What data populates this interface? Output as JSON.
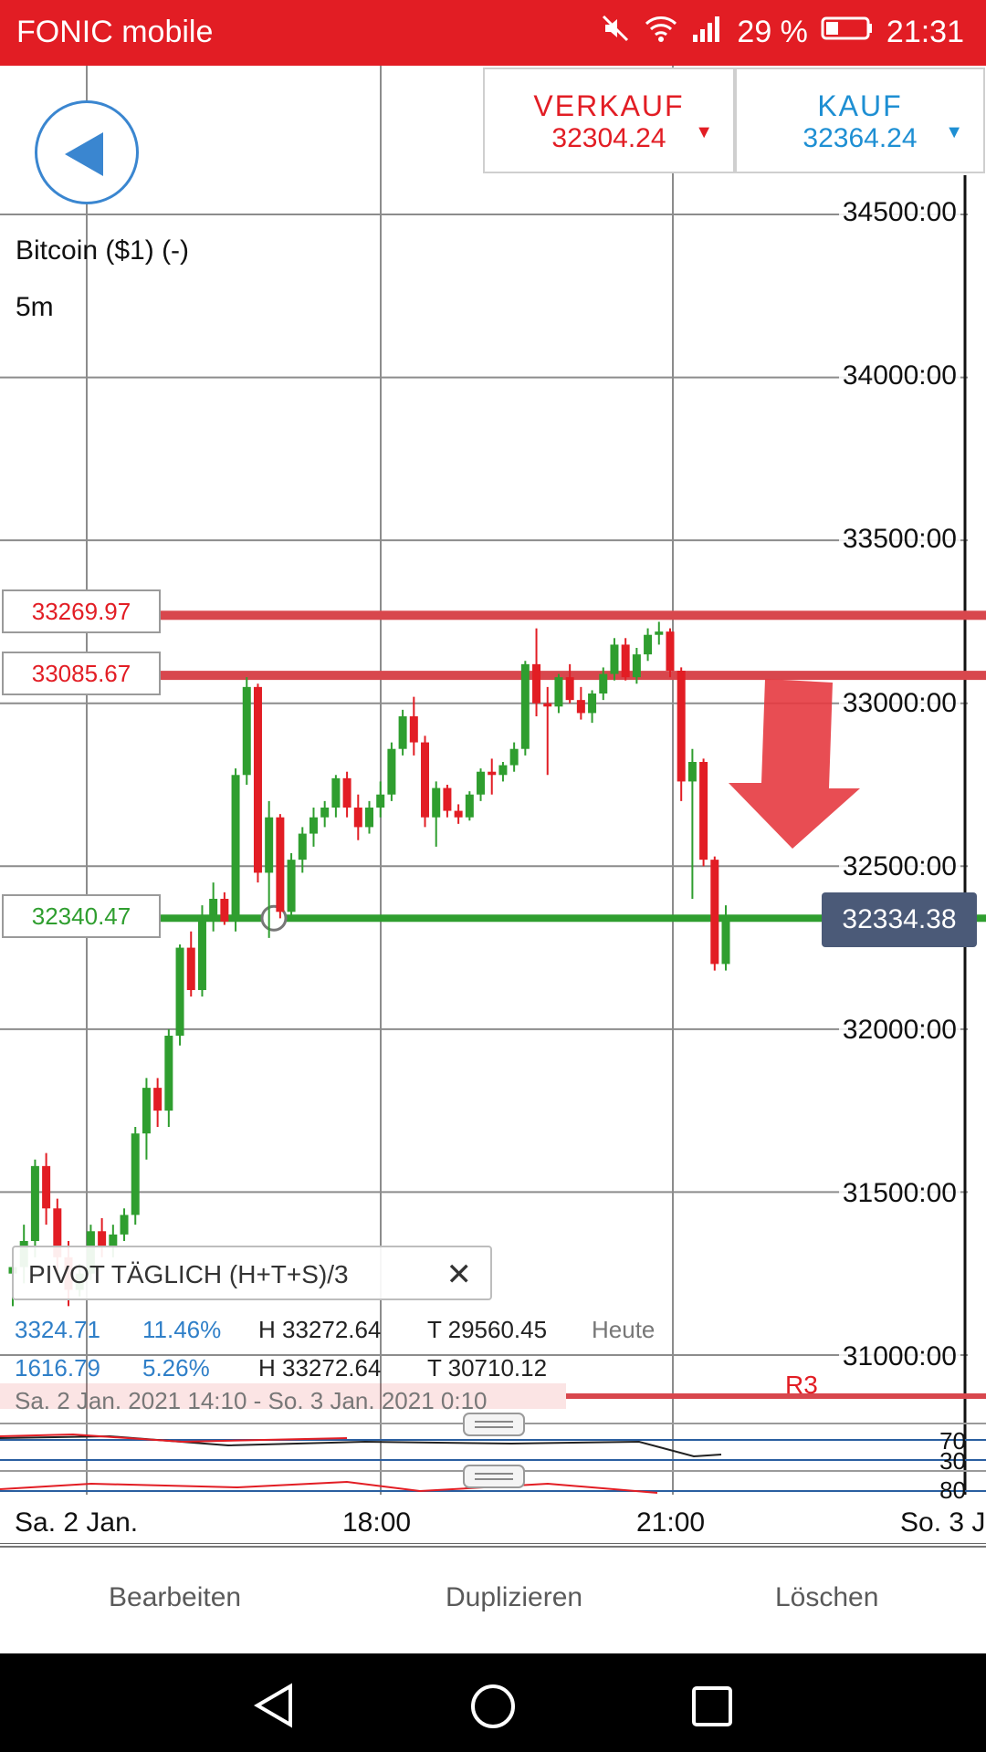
{
  "status_bar": {
    "carrier": "FONIC mobile",
    "battery": "29 %",
    "time": "21:31"
  },
  "trade": {
    "sell_label": "VERKAUF",
    "sell_price": "32304.24",
    "buy_label": "KAUF",
    "buy_price": "32364.24"
  },
  "instrument": {
    "name": "Bitcoin ($1) (-)",
    "timeframe": "5m"
  },
  "levels": {
    "upper": "33269.97",
    "lower": "33085.67",
    "current_line": "32340.47"
  },
  "current_price": "32334.38",
  "y_ticks": [
    "34500:00",
    "34000:00",
    "33500:00",
    "33000:00",
    "32500:00",
    "32000:00",
    "31500:00",
    "31000:00"
  ],
  "x_ticks": [
    "Sa. 2 Jan.",
    "18:00",
    "21:00",
    "So. 3 J"
  ],
  "pivot": {
    "label": "PIVOT  TÄGLICH   (H+T+S)/3",
    "row1": {
      "a": "3324.71",
      "b": "11.46%",
      "h": "H 33272.64",
      "t": "T 29560.45",
      "day": "Heute"
    },
    "row2": {
      "a": "1616.79",
      "b": "5.26%",
      "h": "H 33272.64",
      "t": "T 30710.12"
    },
    "range": "Sa. 2 Jan. 2021 14:10 - So. 3 Jan. 2021 0:10",
    "r3": "R3"
  },
  "oscillator_ticks": [
    "70",
    "30",
    "80"
  ],
  "actions": {
    "edit": "Bearbeiten",
    "duplicate": "Duplizieren",
    "delete": "Löschen"
  },
  "colors": {
    "brand": "#e21d24",
    "up": "#2f9e2f",
    "down": "#e21d24",
    "buy": "#1e8fd3"
  },
  "chart_data": {
    "type": "candlestick",
    "ylim": [
      30880,
      34800
    ],
    "candles": [
      {
        "o": 31250,
        "h": 31300,
        "l": 31150,
        "c": 31270
      },
      {
        "o": 31270,
        "h": 31400,
        "l": 31220,
        "c": 31350
      },
      {
        "o": 31350,
        "h": 31600,
        "l": 31300,
        "c": 31580
      },
      {
        "o": 31580,
        "h": 31620,
        "l": 31400,
        "c": 31450
      },
      {
        "o": 31450,
        "h": 31480,
        "l": 31250,
        "c": 31300
      },
      {
        "o": 31300,
        "h": 31350,
        "l": 31150,
        "c": 31200
      },
      {
        "o": 31200,
        "h": 31280,
        "l": 31180,
        "c": 31250
      },
      {
        "o": 31250,
        "h": 31400,
        "l": 31230,
        "c": 31380
      },
      {
        "o": 31380,
        "h": 31420,
        "l": 31300,
        "c": 31330
      },
      {
        "o": 31330,
        "h": 31400,
        "l": 31300,
        "c": 31370
      },
      {
        "o": 31370,
        "h": 31450,
        "l": 31350,
        "c": 31430
      },
      {
        "o": 31430,
        "h": 31700,
        "l": 31400,
        "c": 31680
      },
      {
        "o": 31680,
        "h": 31850,
        "l": 31600,
        "c": 31820
      },
      {
        "o": 31820,
        "h": 31850,
        "l": 31700,
        "c": 31750
      },
      {
        "o": 31750,
        "h": 32000,
        "l": 31700,
        "c": 31980
      },
      {
        "o": 31980,
        "h": 32260,
        "l": 31950,
        "c": 32250
      },
      {
        "o": 32250,
        "h": 32300,
        "l": 32100,
        "c": 32120
      },
      {
        "o": 32120,
        "h": 32380,
        "l": 32100,
        "c": 32350
      },
      {
        "o": 32350,
        "h": 32450,
        "l": 32300,
        "c": 32400
      },
      {
        "o": 32400,
        "h": 32420,
        "l": 32320,
        "c": 32330
      },
      {
        "o": 32330,
        "h": 32800,
        "l": 32300,
        "c": 32780
      },
      {
        "o": 32780,
        "h": 33080,
        "l": 32750,
        "c": 33050
      },
      {
        "o": 33050,
        "h": 33060,
        "l": 32450,
        "c": 32480
      },
      {
        "o": 32480,
        "h": 32700,
        "l": 32280,
        "c": 32650
      },
      {
        "o": 32650,
        "h": 32660,
        "l": 32340,
        "c": 32360
      },
      {
        "o": 32360,
        "h": 32540,
        "l": 32340,
        "c": 32520
      },
      {
        "o": 32520,
        "h": 32620,
        "l": 32480,
        "c": 32600
      },
      {
        "o": 32600,
        "h": 32680,
        "l": 32560,
        "c": 32650
      },
      {
        "o": 32650,
        "h": 32700,
        "l": 32620,
        "c": 32680
      },
      {
        "o": 32680,
        "h": 32780,
        "l": 32650,
        "c": 32770
      },
      {
        "o": 32770,
        "h": 32790,
        "l": 32650,
        "c": 32680
      },
      {
        "o": 32680,
        "h": 32720,
        "l": 32580,
        "c": 32620
      },
      {
        "o": 32620,
        "h": 32700,
        "l": 32600,
        "c": 32680
      },
      {
        "o": 32680,
        "h": 32760,
        "l": 32650,
        "c": 32720
      },
      {
        "o": 32720,
        "h": 32880,
        "l": 32700,
        "c": 32860
      },
      {
        "o": 32860,
        "h": 32980,
        "l": 32840,
        "c": 32960
      },
      {
        "o": 32960,
        "h": 33020,
        "l": 32840,
        "c": 32880
      },
      {
        "o": 32880,
        "h": 32900,
        "l": 32620,
        "c": 32650
      },
      {
        "o": 32650,
        "h": 32760,
        "l": 32560,
        "c": 32740
      },
      {
        "o": 32740,
        "h": 32750,
        "l": 32650,
        "c": 32670
      },
      {
        "o": 32670,
        "h": 32690,
        "l": 32630,
        "c": 32650
      },
      {
        "o": 32650,
        "h": 32730,
        "l": 32640,
        "c": 32720
      },
      {
        "o": 32720,
        "h": 32800,
        "l": 32700,
        "c": 32790
      },
      {
        "o": 32790,
        "h": 32830,
        "l": 32720,
        "c": 32780
      },
      {
        "o": 32780,
        "h": 32820,
        "l": 32760,
        "c": 32810
      },
      {
        "o": 32810,
        "h": 32880,
        "l": 32790,
        "c": 32860
      },
      {
        "o": 32860,
        "h": 33130,
        "l": 32840,
        "c": 33120
      },
      {
        "o": 33120,
        "h": 33230,
        "l": 32960,
        "c": 33000
      },
      {
        "o": 33000,
        "h": 33050,
        "l": 32780,
        "c": 32990
      },
      {
        "o": 32990,
        "h": 33090,
        "l": 32970,
        "c": 33080
      },
      {
        "o": 33080,
        "h": 33120,
        "l": 33000,
        "c": 33010
      },
      {
        "o": 33010,
        "h": 33050,
        "l": 32950,
        "c": 32970
      },
      {
        "o": 32970,
        "h": 33040,
        "l": 32940,
        "c": 33030
      },
      {
        "o": 33030,
        "h": 33110,
        "l": 33010,
        "c": 33090
      },
      {
        "o": 33090,
        "h": 33200,
        "l": 33070,
        "c": 33180
      },
      {
        "o": 33180,
        "h": 33200,
        "l": 33070,
        "c": 33080
      },
      {
        "o": 33080,
        "h": 33170,
        "l": 33060,
        "c": 33150
      },
      {
        "o": 33150,
        "h": 33230,
        "l": 33130,
        "c": 33210
      },
      {
        "o": 33210,
        "h": 33250,
        "l": 33180,
        "c": 33220
      },
      {
        "o": 33220,
        "h": 33230,
        "l": 33080,
        "c": 33100
      },
      {
        "o": 33100,
        "h": 33110,
        "l": 32700,
        "c": 32760
      },
      {
        "o": 32760,
        "h": 32860,
        "l": 32400,
        "c": 32820
      },
      {
        "o": 32820,
        "h": 32830,
        "l": 32500,
        "c": 32520
      },
      {
        "o": 32520,
        "h": 32530,
        "l": 32180,
        "c": 32200
      },
      {
        "o": 32200,
        "h": 32380,
        "l": 32180,
        "c": 32340
      }
    ]
  }
}
